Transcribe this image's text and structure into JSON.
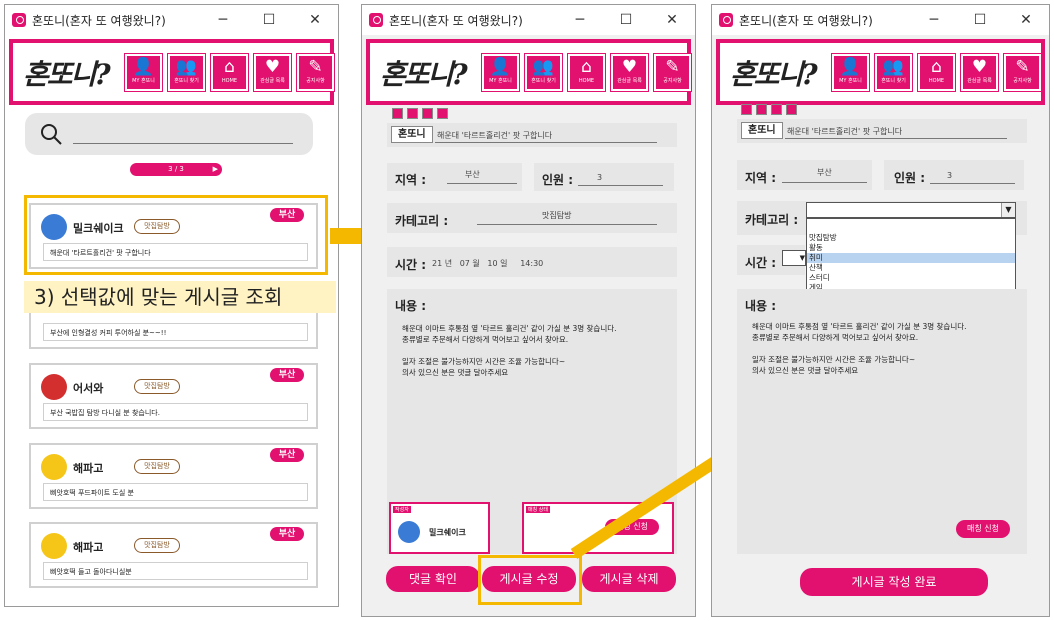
{
  "app": {
    "title": "혼또니(혼자 또 여행왔니?)",
    "logo": "혼또니?",
    "min": "─",
    "max": "☐",
    "close": "✕"
  },
  "nav": [
    {
      "icon": "👤",
      "label": "MY 혼또니"
    },
    {
      "icon": "👥",
      "label": "혼또니 찾기"
    },
    {
      "icon": "⌂",
      "label": "HOME"
    },
    {
      "icon": "♥",
      "label": "관심글 목록"
    },
    {
      "icon": "✎",
      "label": "공지사항"
    }
  ],
  "list": {
    "pager": "3 / 3",
    "pager_arrow": "▶",
    "search_icon": "search-icon",
    "cards": [
      {
        "name": "밀크쉐이크",
        "tag": "맛집탐방",
        "region": "부산",
        "text": "해운대 '타르트홀리건' 팟 구합니다",
        "color": "#3a7bd5"
      },
      {
        "text": "부산에 인형결성 커피 투어하실 분~~!!"
      },
      {
        "name": "어서와",
        "tag": "맛집탐방",
        "region": "부산",
        "text": "부산 국밥집 탐방 다니실 분 찾습니다.",
        "color": "#d32f2f"
      },
      {
        "name": "해파고",
        "tag": "맛집탐방",
        "region": "부산",
        "text": "삐앗호떡 푸드파이트 도실 분",
        "color": "#f5c518"
      },
      {
        "name": "해파고",
        "tag": "맛집탐방",
        "region": "부산",
        "text": "삐앗호떡 들고 돌아다니실분",
        "color": "#f5c518"
      }
    ]
  },
  "annotation": {
    "caption": "3) 선택값에 맞는 게시글 조회"
  },
  "detail": {
    "tag": "혼또니",
    "title": "해운대 '타르트홀리건' 팟 구합니다",
    "region_label": "지역 :",
    "region_value": "부산",
    "people_label": "인원 :",
    "people_value": "3",
    "category_label": "카테고리 :",
    "category_value": "맛집탐방",
    "time_label": "시간 :",
    "time_value": "21 년   07 월   10 일     14:30",
    "content_label": "내용 :",
    "content": [
      "해운대 이마트 후통점 옆 '타르트 홀리건' 같이 가실 분 3명 찾습니다.",
      "종류별로 주문해서 다양하게 먹어보고 싶어서 찾아요.",
      "",
      "일자 조절은 불가능하지만 시간은 조율 가능합니다~",
      "의사 있으신 분은 댓글 달아주세요"
    ],
    "writer_tag": "작성자",
    "writer": "밀크쉐이크",
    "status_tag": "매칭 상태",
    "apply": "매칭 신청",
    "btn_comment": "댓글 확인",
    "btn_edit": "게시글 수정",
    "btn_delete": "게시글 삭제"
  },
  "edit": {
    "tag": "혼또니",
    "title": "해운대 '타르트홀리건' 팟 구합니다",
    "region_label": "지역 :",
    "region_value": "부산",
    "people_label": "인원 :",
    "people_value": "3",
    "category_label": "카테고리 :",
    "time_label": "시간 :",
    "content_label": "내용 :",
    "options": [
      "맛집탐방",
      "활동",
      "취미",
      "산책",
      "스터디",
      "게임"
    ],
    "content": [
      "해운대 이마트 후통점 옆 '타르트 홀리건' 같이 가실 분 3명 찾습니다.",
      "종류별로 주문해서 다양하게 먹어보고 싶어서 찾아요.",
      "",
      "일자 조절은 불가능하지만 시간은 조율 가능합니다~",
      "의사 있으신 분은 댓글 달아주세요"
    ],
    "apply": "매칭 신청",
    "submit": "게시글 작성 완료"
  },
  "colors": {
    "accent": "#e2106e",
    "highlight": "#f5b800"
  }
}
